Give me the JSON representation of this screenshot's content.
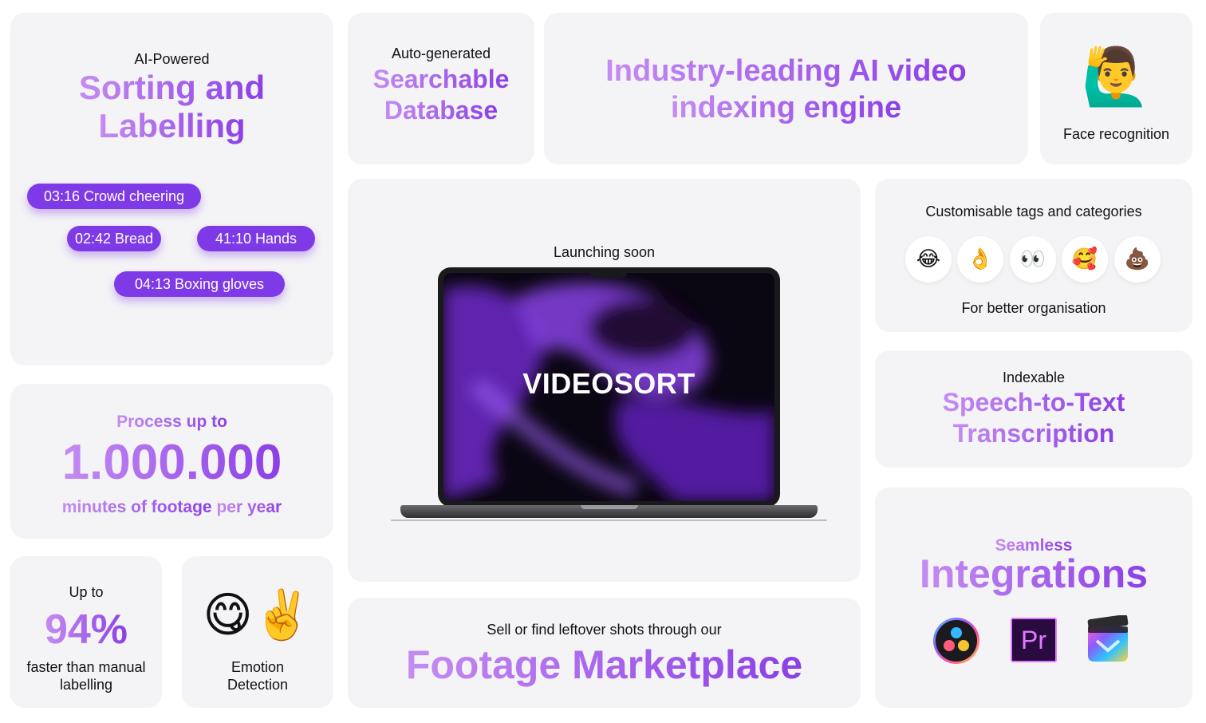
{
  "sorting": {
    "kicker": "AI-Powered",
    "title_line1": "Sorting and",
    "title_line2": "Labelling",
    "tags": [
      "03:16 Crowd cheering",
      "02:42 Bread",
      "41:10 Hands",
      "04:13 Boxing gloves"
    ]
  },
  "database": {
    "kicker": "Auto-generated",
    "title_line1": "Searchable",
    "title_line2": "Database"
  },
  "engine": {
    "title_line1": "Industry-leading AI video",
    "title_line2": "indexing engine"
  },
  "face": {
    "emoji": "🙋‍♂️",
    "label": "Face recognition"
  },
  "process": {
    "top": "Process up to",
    "number": "1.000.000",
    "bottom_a": "minutes of footage",
    "bottom_b": "per year"
  },
  "speed": {
    "top": "Up to",
    "value": "94%",
    "bottom_line1": "faster than manual",
    "bottom_line2": "labelling"
  },
  "emotion": {
    "emoji1": "😋",
    "emoji2": "✌️",
    "label_line1": "Emotion",
    "label_line2": "Detection"
  },
  "launch": {
    "kicker": "Launching soon",
    "screen_title": "VIDEOSORT"
  },
  "tags": {
    "title": "Customisable tags and categories",
    "emojis": [
      "😂",
      "👌",
      "👀",
      "🥰",
      "💩"
    ],
    "caption": "For better organisation"
  },
  "speech": {
    "kicker": "Indexable",
    "title_line1": "Speech-to-Text",
    "title_line2": "Transcription"
  },
  "marketplace": {
    "kicker": "Sell or find leftover shots through our",
    "title": "Footage Marketplace"
  },
  "integrations": {
    "kicker": "Seamless",
    "title": "Integrations",
    "apps": [
      {
        "icon": "davinci-resolve-icon"
      },
      {
        "icon": "premiere-pro-icon",
        "text": "Pr"
      },
      {
        "icon": "final-cut-pro-icon"
      }
    ]
  }
}
